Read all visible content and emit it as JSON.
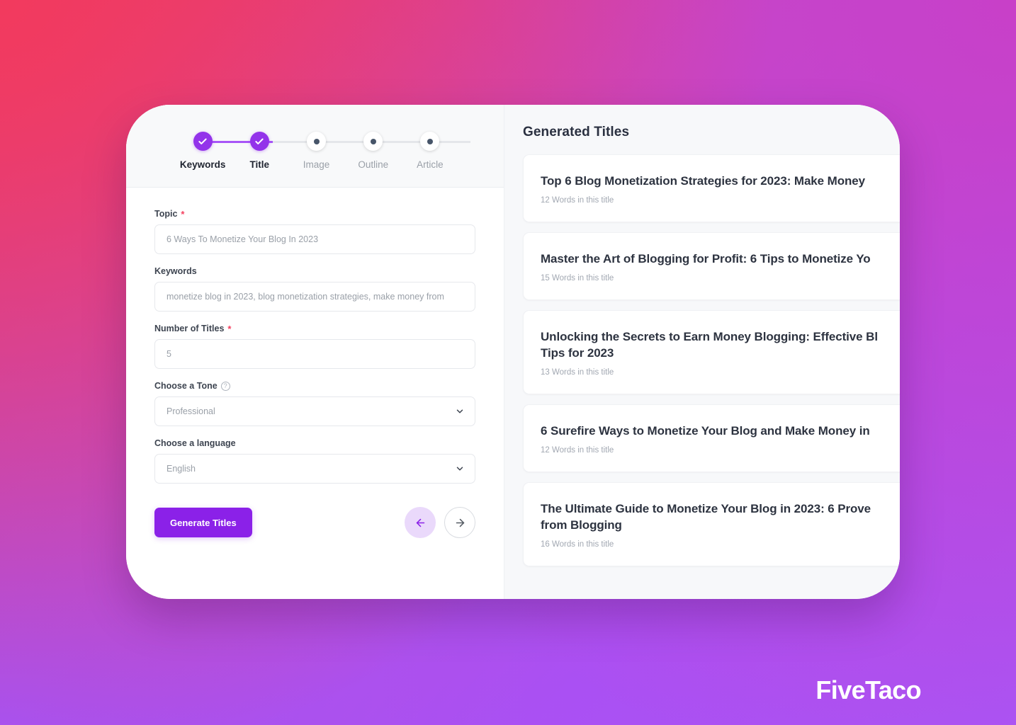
{
  "stepper": {
    "steps": [
      {
        "label": "Keywords",
        "state": "done",
        "icon": "check-icon"
      },
      {
        "label": "Title",
        "state": "done",
        "icon": "check-icon"
      },
      {
        "label": "Image",
        "state": "pending",
        "icon": "dot-icon"
      },
      {
        "label": "Outline",
        "state": "pending",
        "icon": "dot-icon"
      },
      {
        "label": "Article",
        "state": "pending",
        "icon": "dot-icon"
      }
    ]
  },
  "form": {
    "topic": {
      "label": "Topic",
      "required_marker": "*",
      "value": "6 Ways To Monetize Your Blog In 2023",
      "placeholder": "6 Ways To Monetize Your Blog In 2023"
    },
    "keywords": {
      "label": "Keywords",
      "value": "monetize blog in 2023, blog monetization strategies, make money from",
      "placeholder": "monetize blog in 2023, blog monetization strategies, make money from"
    },
    "number_of_titles": {
      "label": "Number of Titles",
      "required_marker": "*",
      "value": "5",
      "placeholder": "5"
    },
    "tone": {
      "label": "Choose a Tone",
      "help_icon": "question-mark-icon",
      "value": "Professional",
      "placeholder": "Professional"
    },
    "language": {
      "label": "Choose a language",
      "value": "English",
      "placeholder": "English"
    },
    "generate_button": "Generate Titles",
    "prev_button_icon": "arrow-left-icon",
    "next_button_icon": "arrow-right-icon"
  },
  "results": {
    "heading": "Generated Titles",
    "items": [
      {
        "title": "Top 6 Blog Monetization Strategies for 2023: Make Money",
        "meta": "12 Words in this title"
      },
      {
        "title": "Master the Art of Blogging for Profit: 6 Tips to Monetize Yo",
        "meta": "15 Words in this title"
      },
      {
        "title": "Unlocking the Secrets to Earn Money Blogging: Effective Bl\nTips for 2023",
        "meta": "13 Words in this title"
      },
      {
        "title": "6 Surefire Ways to Monetize Your Blog and Make Money in",
        "meta": "12 Words in this title"
      },
      {
        "title": "The Ultimate Guide to Monetize Your Blog in 2023: 6 Prove\nfrom Blogging",
        "meta": "16 Words in this title"
      }
    ]
  },
  "watermark": {
    "text": "FiveTaco"
  },
  "colors": {
    "accent_purple": "#8b21e8",
    "step_active": "#9333ea",
    "required_star": "#f43f5e",
    "bg_gradient_start": "#ef3a63",
    "bg_gradient_mid": "#c44cc8",
    "bg_gradient_end": "#a855f7",
    "panel_bg": "#f7f8fa"
  }
}
